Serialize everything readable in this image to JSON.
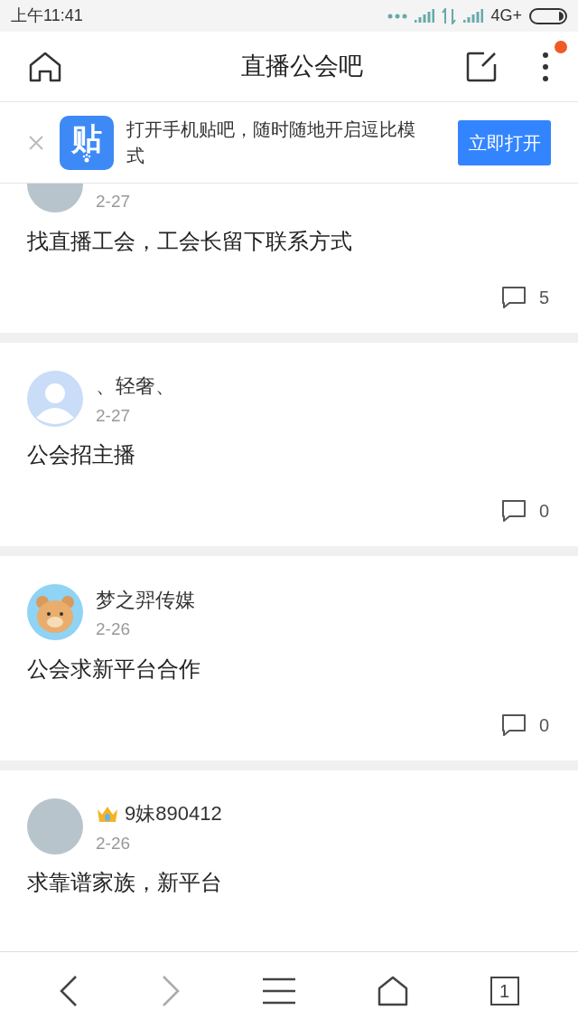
{
  "status_bar": {
    "time": "上午11:41",
    "network": "4G+"
  },
  "header": {
    "title": "直播公会吧",
    "more_badge": true
  },
  "banner": {
    "logo_text": "贴",
    "text": "打开手机贴吧，随时随地开启逗比模式",
    "button": "立即打开"
  },
  "posts": [
    {
      "avatar": {
        "kind": "photo"
      },
      "crowned": false,
      "date": "2-27",
      "title": "找直播工会，工会长留下联系方式",
      "comments": "5",
      "clipped": true
    },
    {
      "avatar": {
        "kind": "silhouette"
      },
      "author": "、轻奢、",
      "crowned": false,
      "date": "2-27",
      "title": "公会招主播",
      "comments": "0",
      "clipped": false
    },
    {
      "avatar": {
        "kind": "cartoon"
      },
      "author": "梦之羿传媒",
      "crowned": false,
      "date": "2-26",
      "title": "公会求新平台合作",
      "comments": "0",
      "clipped": false
    },
    {
      "avatar": {
        "kind": "photo"
      },
      "author": "9妹890412",
      "crowned": true,
      "date": "2-26",
      "title": "求靠谱家族，新平台",
      "clipped": false
    }
  ],
  "bottom_nav": [
    {
      "kind": "back",
      "disabled": false
    },
    {
      "kind": "forward",
      "disabled": true
    },
    {
      "kind": "menu",
      "disabled": false
    },
    {
      "kind": "home",
      "disabled": false
    },
    {
      "kind": "tabs",
      "label": "1",
      "disabled": false
    }
  ]
}
